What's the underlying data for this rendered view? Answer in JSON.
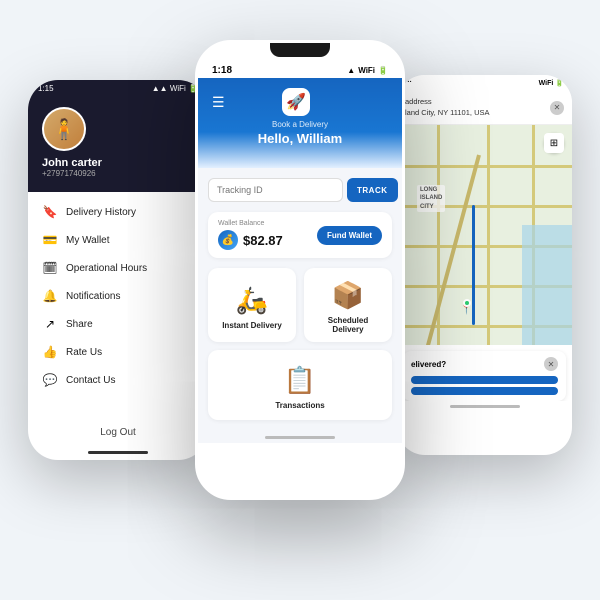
{
  "left_phone": {
    "status_time": "1:15",
    "user_name": "John carter",
    "user_phone": "+27971740926",
    "avatar_emoji": "🧍",
    "menu_items": [
      {
        "icon": "🔖",
        "label": "Delivery History"
      },
      {
        "icon": "💳",
        "label": "My Wallet"
      },
      {
        "icon": "🗓",
        "label": "Operational Hours"
      },
      {
        "icon": "🔔",
        "label": "Notifications"
      },
      {
        "icon": "↗",
        "label": "Share"
      },
      {
        "icon": "👍",
        "label": "Rate Us"
      },
      {
        "icon": "💬",
        "label": "Contact Us"
      }
    ],
    "logout_label": "Log Out"
  },
  "center_phone": {
    "status_time": "1:18",
    "app_logo": "🚀",
    "app_subtitle": "Book a Delivery",
    "greeting": "Hello, William",
    "track_placeholder": "Tracking ID",
    "track_button": "TRACK",
    "wallet_label": "Wallet Balance",
    "wallet_amount": "$82.87",
    "fund_button": "Fund Wallet",
    "services": [
      {
        "icon": "🛵",
        "label": "Instant Delivery"
      },
      {
        "icon": "📦",
        "label": "Scheduled Delivery"
      }
    ],
    "transactions_icon": "📋",
    "transactions_label": "Transactions"
  },
  "right_phone": {
    "status_time": "...",
    "address_line1": "address",
    "address_line2": "land City, NY 11101, USA",
    "map_label": "LONG\nISLAND\nCITY",
    "delivered_question": "elivered?",
    "delivered_btn1": "",
    "delivered_btn2": ""
  }
}
